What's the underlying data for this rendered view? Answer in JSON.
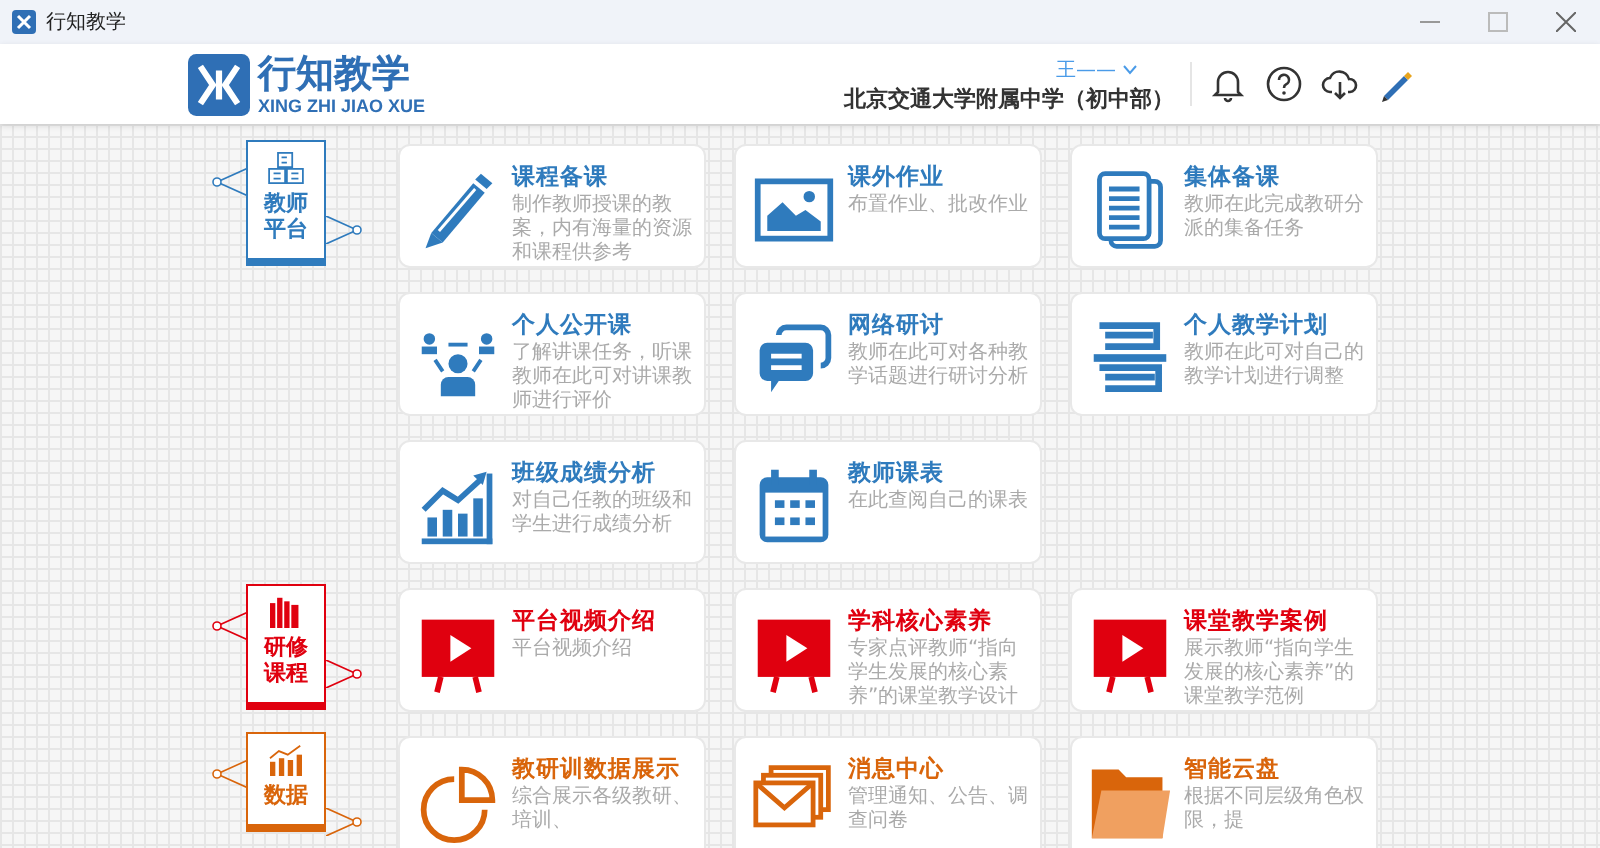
{
  "window": {
    "title": "行知教学"
  },
  "header": {
    "logo_title": "行知教学",
    "logo_subtitle": "XING ZHI JIAO XUE",
    "user": "王——",
    "school": "北京交通大学附属中学（初中部）"
  },
  "sections": [
    {
      "label": "教师平台",
      "color": "#2f7bbd",
      "kind": "blocks",
      "cards": [
        {
          "title": "课程备课",
          "desc": "制作教师授课的教案，内有海量的资源和课程供参考",
          "kind": "pen"
        },
        {
          "title": "课外作业",
          "desc": "布置作业、批改作业",
          "kind": "picture"
        },
        {
          "title": "集体备课",
          "desc": "教师在此完成教研分派的集备任务",
          "kind": "document"
        },
        {
          "title": "个人公开课",
          "desc": "了解讲课任务，听课教师在此可对讲课教师进行评价",
          "kind": "presenter"
        },
        {
          "title": "网络研讨",
          "desc": "教师在此可对各种教学话题进行研讨分析",
          "kind": "chat"
        },
        {
          "title": "个人教学计划",
          "desc": "教师在此可对自己的教学计划进行调整",
          "kind": "books"
        },
        {
          "title": "班级成绩分析",
          "desc": "对自己任教的班级和学生进行成绩分析",
          "kind": "chart"
        },
        {
          "title": "教师课表",
          "desc": "在此查阅自己的课表",
          "kind": "calendar"
        }
      ]
    },
    {
      "label": "研修课程",
      "color": "#e0000f",
      "kind": "books",
      "cards": [
        {
          "title": "平台视频介绍",
          "desc": "平台视频介绍",
          "kind": "video"
        },
        {
          "title": "学科核心素养",
          "desc": "专家点评教师“指向学生发展的核心素养”的课堂教学设计",
          "kind": "video"
        },
        {
          "title": "课堂教学案例",
          "desc": "展示教师“指向学生发展的核心素养”的课堂教学范例",
          "kind": "video"
        }
      ]
    },
    {
      "label": "数据",
      "color": "#d9650b",
      "kind": "chart",
      "cards": [
        {
          "title": "教研训数据展示",
          "desc": "综合展示各级教研、培训、",
          "kind": "pie"
        },
        {
          "title": "消息中心",
          "desc": "管理通知、公告、调查问卷",
          "kind": "mail"
        },
        {
          "title": "智能云盘",
          "desc": "根据不同层级角色权限，提",
          "kind": "folder"
        }
      ]
    }
  ]
}
